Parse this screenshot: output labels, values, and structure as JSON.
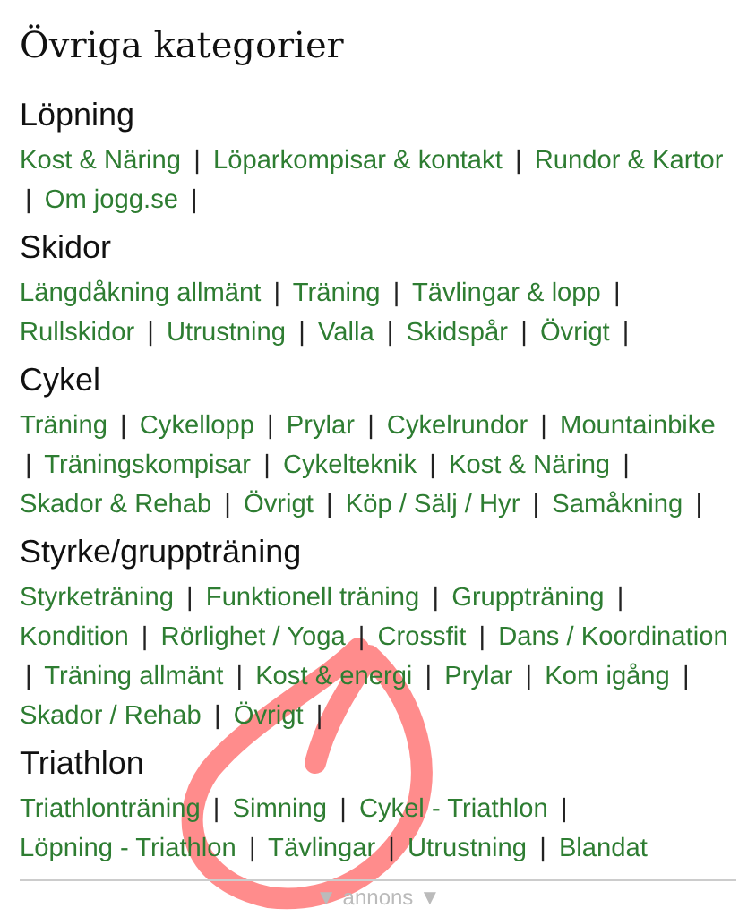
{
  "title": "Övriga kategorier",
  "separator": "|",
  "sections": [
    {
      "heading": "Löpning",
      "trailing_separator": true,
      "links": [
        "Kost & Näring",
        "Löparkompisar & kontakt",
        "Rundor & Kartor",
        "Om jogg.se"
      ]
    },
    {
      "heading": "Skidor",
      "trailing_separator": true,
      "links": [
        "Längdåkning allmänt",
        "Träning",
        "Tävlingar & lopp",
        "Rullskidor",
        "Utrustning",
        "Valla",
        "Skidspår",
        "Övrigt"
      ]
    },
    {
      "heading": "Cykel",
      "trailing_separator": true,
      "links": [
        "Träning",
        "Cykellopp",
        "Prylar",
        "Cykelrundor",
        "Mountainbike",
        "Träningskompisar",
        "Cykelteknik",
        "Kost & Näring",
        "Skador & Rehab",
        "Övrigt",
        "Köp / Sälj / Hyr",
        "Samåkning"
      ]
    },
    {
      "heading": "Styrke/gruppträning",
      "trailing_separator": true,
      "links": [
        "Styrketräning",
        "Funktionell träning",
        "Gruppträning",
        "Kondition",
        "Rörlighet / Yoga",
        "Crossfit",
        "Dans / Koordination",
        "Träning allmänt",
        "Kost & energi",
        "Prylar",
        "Kom igång",
        "Skador / Rehab",
        "Övrigt"
      ]
    },
    {
      "heading": "Triathlon",
      "trailing_separator": false,
      "links": [
        "Triathlonträning",
        "Simning",
        "Cykel - Triathlon",
        "Löpning - Triathlon",
        "Tävlingar",
        "Utrustning",
        "Blandat"
      ]
    }
  ],
  "ad_label": "▼ annons ▼"
}
